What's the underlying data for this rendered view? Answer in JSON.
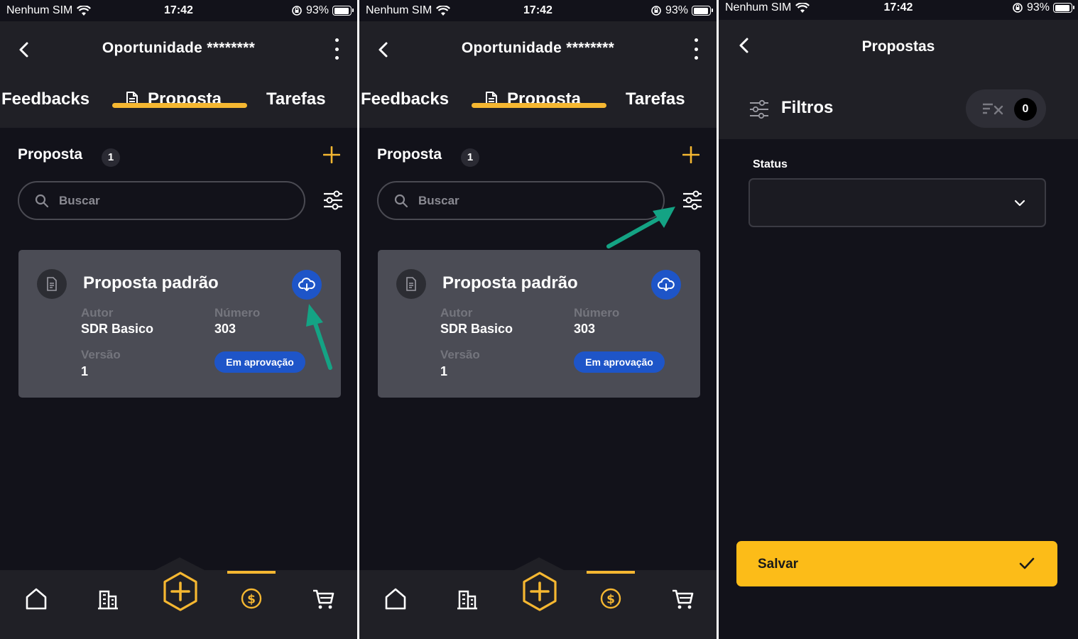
{
  "statusbar": {
    "carrier": "Nenhum SIM",
    "time": "17:42",
    "battery": "93%"
  },
  "screen1": {
    "header_title": "Oportunidade ********",
    "tabs": [
      {
        "label": "Feedbacks"
      },
      {
        "label": "Proposta"
      },
      {
        "label": "Tarefas"
      }
    ],
    "active_tab": "Proposta",
    "section_title": "Proposta",
    "count": "1",
    "search_placeholder": "Buscar",
    "card": {
      "title": "Proposta padrão",
      "author_label": "Autor",
      "author": "SDR Basico",
      "number_label": "Número",
      "number": "303",
      "version_label": "Versão",
      "version": "1",
      "status": "Em aprovação"
    },
    "nav": [
      "home-icon",
      "building-icon",
      "add-icon",
      "dollar-icon",
      "cart-icon"
    ]
  },
  "screen2": {
    "header_title": "Oportunidade ********",
    "tabs": [
      {
        "label": "Feedbacks"
      },
      {
        "label": "Proposta"
      },
      {
        "label": "Tarefas"
      }
    ],
    "section_title": "Proposta",
    "count": "1",
    "search_placeholder": "Buscar",
    "card": {
      "title": "Proposta padrão",
      "author_label": "Autor",
      "author": "SDR Basico",
      "number_label": "Número",
      "number": "303",
      "version_label": "Versão",
      "version": "1",
      "status": "Em aprovação"
    }
  },
  "screen3": {
    "header_title": "Propostas",
    "filters_label": "Filtros",
    "filter_count": "0",
    "status_label": "Status",
    "status_value": "",
    "save_label": "Salvar"
  },
  "colors": {
    "accent": "#f5b731",
    "blue": "#1e55c8",
    "arrow": "#14a384",
    "background": "#12121a"
  }
}
